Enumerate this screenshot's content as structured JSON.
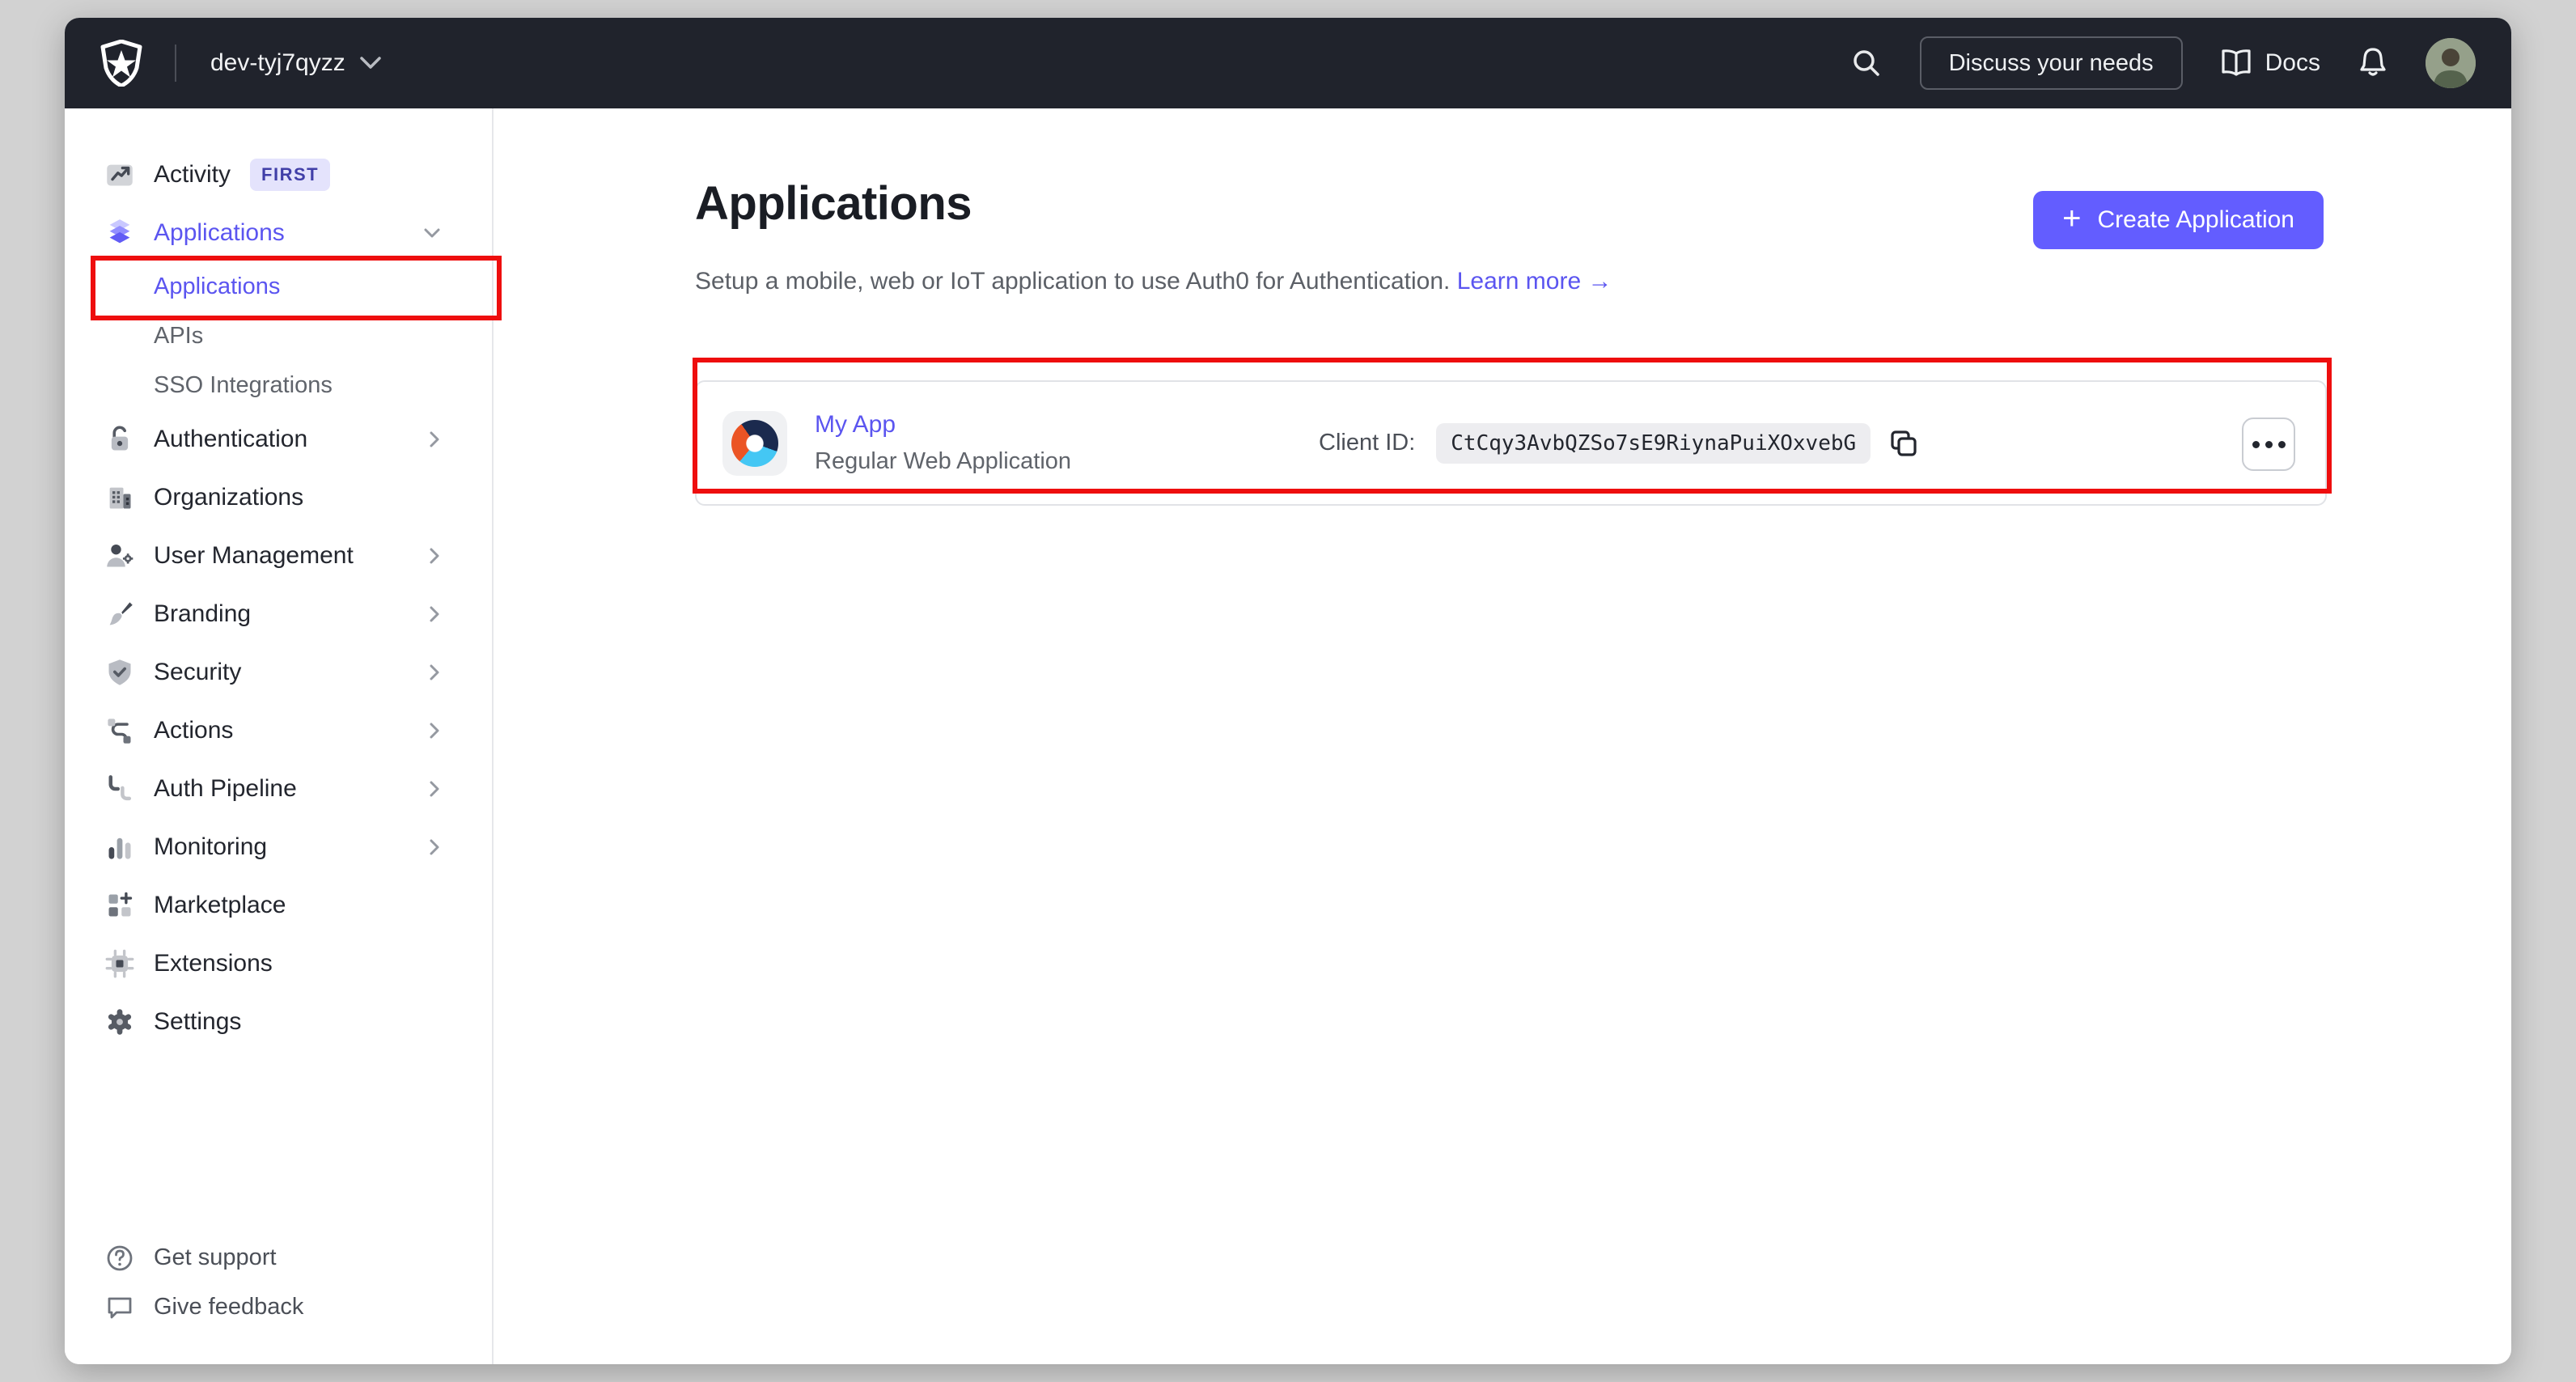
{
  "navbar": {
    "tenant": "dev-tyj7qyzz",
    "discuss_button": "Discuss your needs",
    "docs_label": "Docs"
  },
  "sidebar": {
    "items": [
      {
        "label": "Activity",
        "badge": "FIRST"
      },
      {
        "label": "Applications"
      },
      {
        "label": "Applications"
      },
      {
        "label": "APIs"
      },
      {
        "label": "SSO Integrations"
      },
      {
        "label": "Authentication"
      },
      {
        "label": "Organizations"
      },
      {
        "label": "User Management"
      },
      {
        "label": "Branding"
      },
      {
        "label": "Security"
      },
      {
        "label": "Actions"
      },
      {
        "label": "Auth Pipeline"
      },
      {
        "label": "Monitoring"
      },
      {
        "label": "Marketplace"
      },
      {
        "label": "Extensions"
      },
      {
        "label": "Settings"
      }
    ],
    "footer": [
      {
        "label": "Get support"
      },
      {
        "label": "Give feedback"
      }
    ]
  },
  "main": {
    "title": "Applications",
    "subtitle": "Setup a mobile, web or IoT application to use Auth0 for Authentication.",
    "learn_more": "Learn more",
    "arrow": "→",
    "create_button": "Create Application",
    "plus": "+",
    "app": {
      "name": "My App",
      "type": "Regular Web Application",
      "client_id_label": "Client ID:",
      "client_id": "CtCqy3AvbQZSo7sE9RiynaPuiXOxvebG"
    }
  },
  "colors": {
    "accent": "#635dff",
    "navbar_bg": "#20232c",
    "annotation": "#ee0e0e",
    "logo_orange": "#eb5424",
    "logo_navy": "#1b2a4e",
    "logo_blue": "#44c7f4",
    "badge_bg": "#e4e3fc",
    "badge_text": "#413fa8"
  }
}
